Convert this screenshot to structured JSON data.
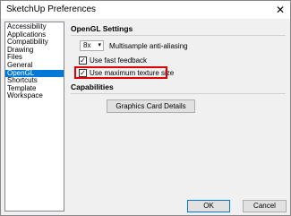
{
  "window": {
    "title": "SketchUp Preferences",
    "close_label": "✕"
  },
  "sidebar": {
    "items": [
      {
        "label": "Accessibility",
        "selected": false
      },
      {
        "label": "Applications",
        "selected": false
      },
      {
        "label": "Compatibility",
        "selected": false
      },
      {
        "label": "Drawing",
        "selected": false
      },
      {
        "label": "Files",
        "selected": false
      },
      {
        "label": "General",
        "selected": false
      },
      {
        "label": "OpenGL",
        "selected": true
      },
      {
        "label": "Shortcuts",
        "selected": false
      },
      {
        "label": "Template",
        "selected": false
      },
      {
        "label": "Workspace",
        "selected": false
      }
    ]
  },
  "opengl": {
    "title": "OpenGL Settings",
    "msaa_value": "8x",
    "msaa_label": "Multisample anti-aliasing",
    "fast_feedback_label": "Use fast feedback",
    "fast_feedback_checked": true,
    "max_texture_label": "Use maximum texture size",
    "max_texture_checked": true
  },
  "capabilities": {
    "title": "Capabilities",
    "graphics_button": "Graphics Card Details"
  },
  "footer": {
    "ok": "OK",
    "cancel": "Cancel"
  },
  "colors": {
    "selection": "#0078d7",
    "highlight": "#e00000"
  }
}
